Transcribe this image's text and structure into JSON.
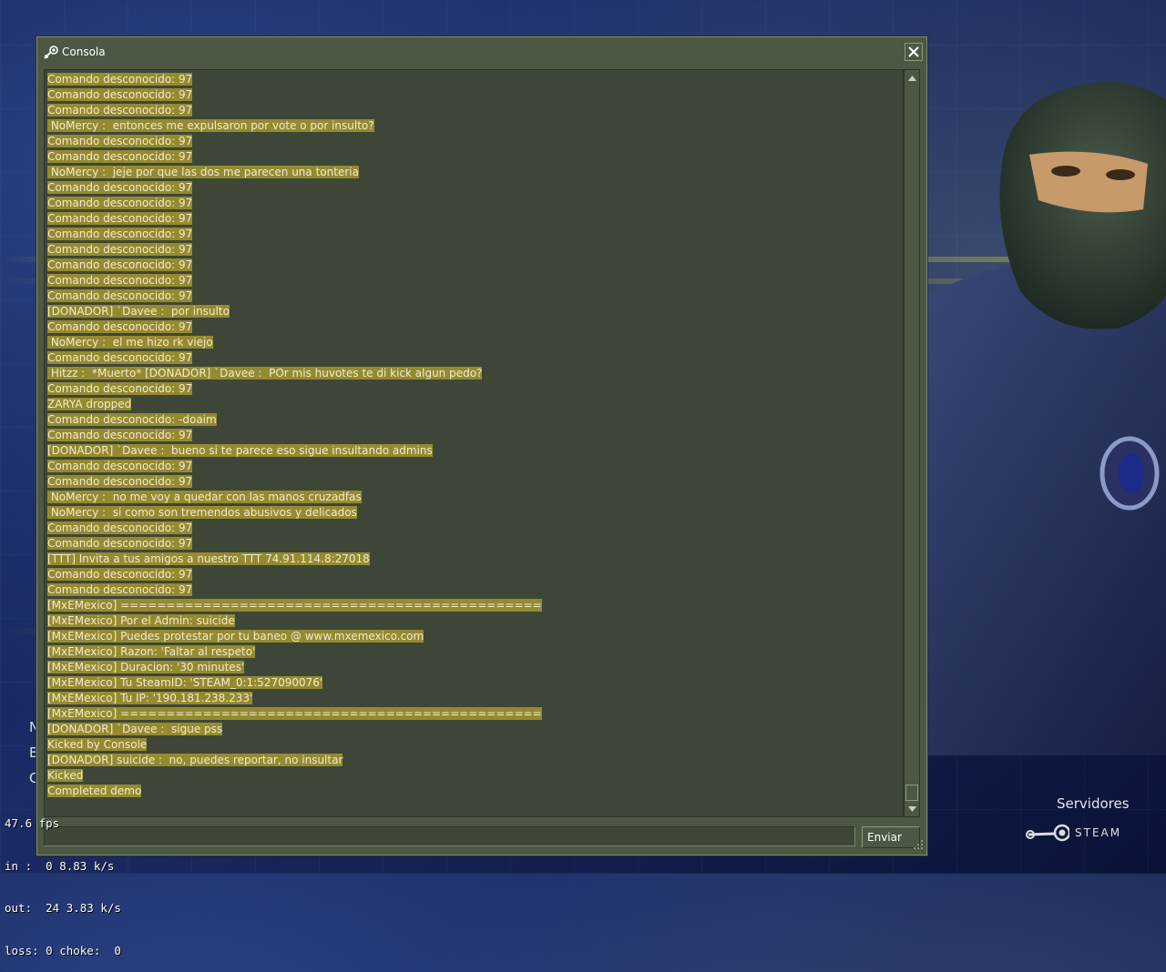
{
  "window": {
    "title": "Consola",
    "send_label": "Enviar",
    "input_value": ""
  },
  "log": [
    "Comando desconocido: 97",
    "Comando desconocido: 97",
    "Comando desconocido: 97",
    " NoMercy :  entonces me expulsaron por vote o por insulto?",
    "Comando desconocido: 97",
    "Comando desconocido: 97",
    " NoMercy :  jeje por que las dos me parecen una tonteria",
    "Comando desconocido: 97",
    "Comando desconocido: 97",
    "Comando desconocido: 97",
    "Comando desconocido: 97",
    "Comando desconocido: 97",
    "Comando desconocido: 97",
    "Comando desconocido: 97",
    "Comando desconocido: 97",
    "[DONADOR] `Davee :  por insulto",
    "Comando desconocido: 97",
    " NoMercy :  el me hizo rk viejo",
    "Comando desconocido: 97",
    " Hitzz :  *Muerto* [DONADOR] `Davee :  POr mis huvotes te di kick algun pedo?",
    "Comando desconocido: 97",
    "ZARYA dropped",
    "Comando desconocido: -doaim",
    "Comando desconocido: 97",
    "[DONADOR] `Davee :  bueno si te parece eso sigue insultando admins",
    "Comando desconocido: 97",
    "Comando desconocido: 97",
    " NoMercy :  no me voy a quedar con las manos cruzadfas",
    " NoMercy :  si como son tremendos abusivos y delicados",
    "Comando desconocido: 97",
    "Comando desconocido: 97",
    "[TTT] Invita a tus amigos a nuestro TTT 74.91.114.8:27018",
    "Comando desconocido: 97",
    "Comando desconocido: 97",
    "[MxEMexico] ==============================================",
    "[MxEMexico] Por el Admin: suicide",
    "[MxEMexico] Puedes protestar por tu baneo @ www.mxemexico.com",
    "[MxEMexico] Razon: 'Faltar al respeto'",
    "[MxEMexico] Duracion: '30 minutes'",
    "[MxEMexico] Tu SteamID: 'STEAM_0:1:527090076'",
    "[MxEMexico] Tu IP: '190.181.238.233'",
    "[MxEMexico] ==============================================",
    "[DONADOR] `Davee :  sigue pss",
    "Kicked by Console",
    "[DONADOR] suicide :  no, puedes reportar, no insultar",
    "Kicked",
    "Completed demo"
  ],
  "netgraph": {
    "fps": "47.6 fps",
    "in": "in :  0 8.83 k/s",
    "out": "out:  24 3.83 k/s",
    "loss": "loss: 0 choke:  0"
  },
  "menu_edge": [
    "N",
    "B",
    "C"
  ],
  "servers_label": "Servidores",
  "steam_label": "STEAM",
  "colors": {
    "window_bg": "#4c5844",
    "log_bg": "#3e4637",
    "highlight": "#958a30",
    "text": "#f0eccf"
  }
}
